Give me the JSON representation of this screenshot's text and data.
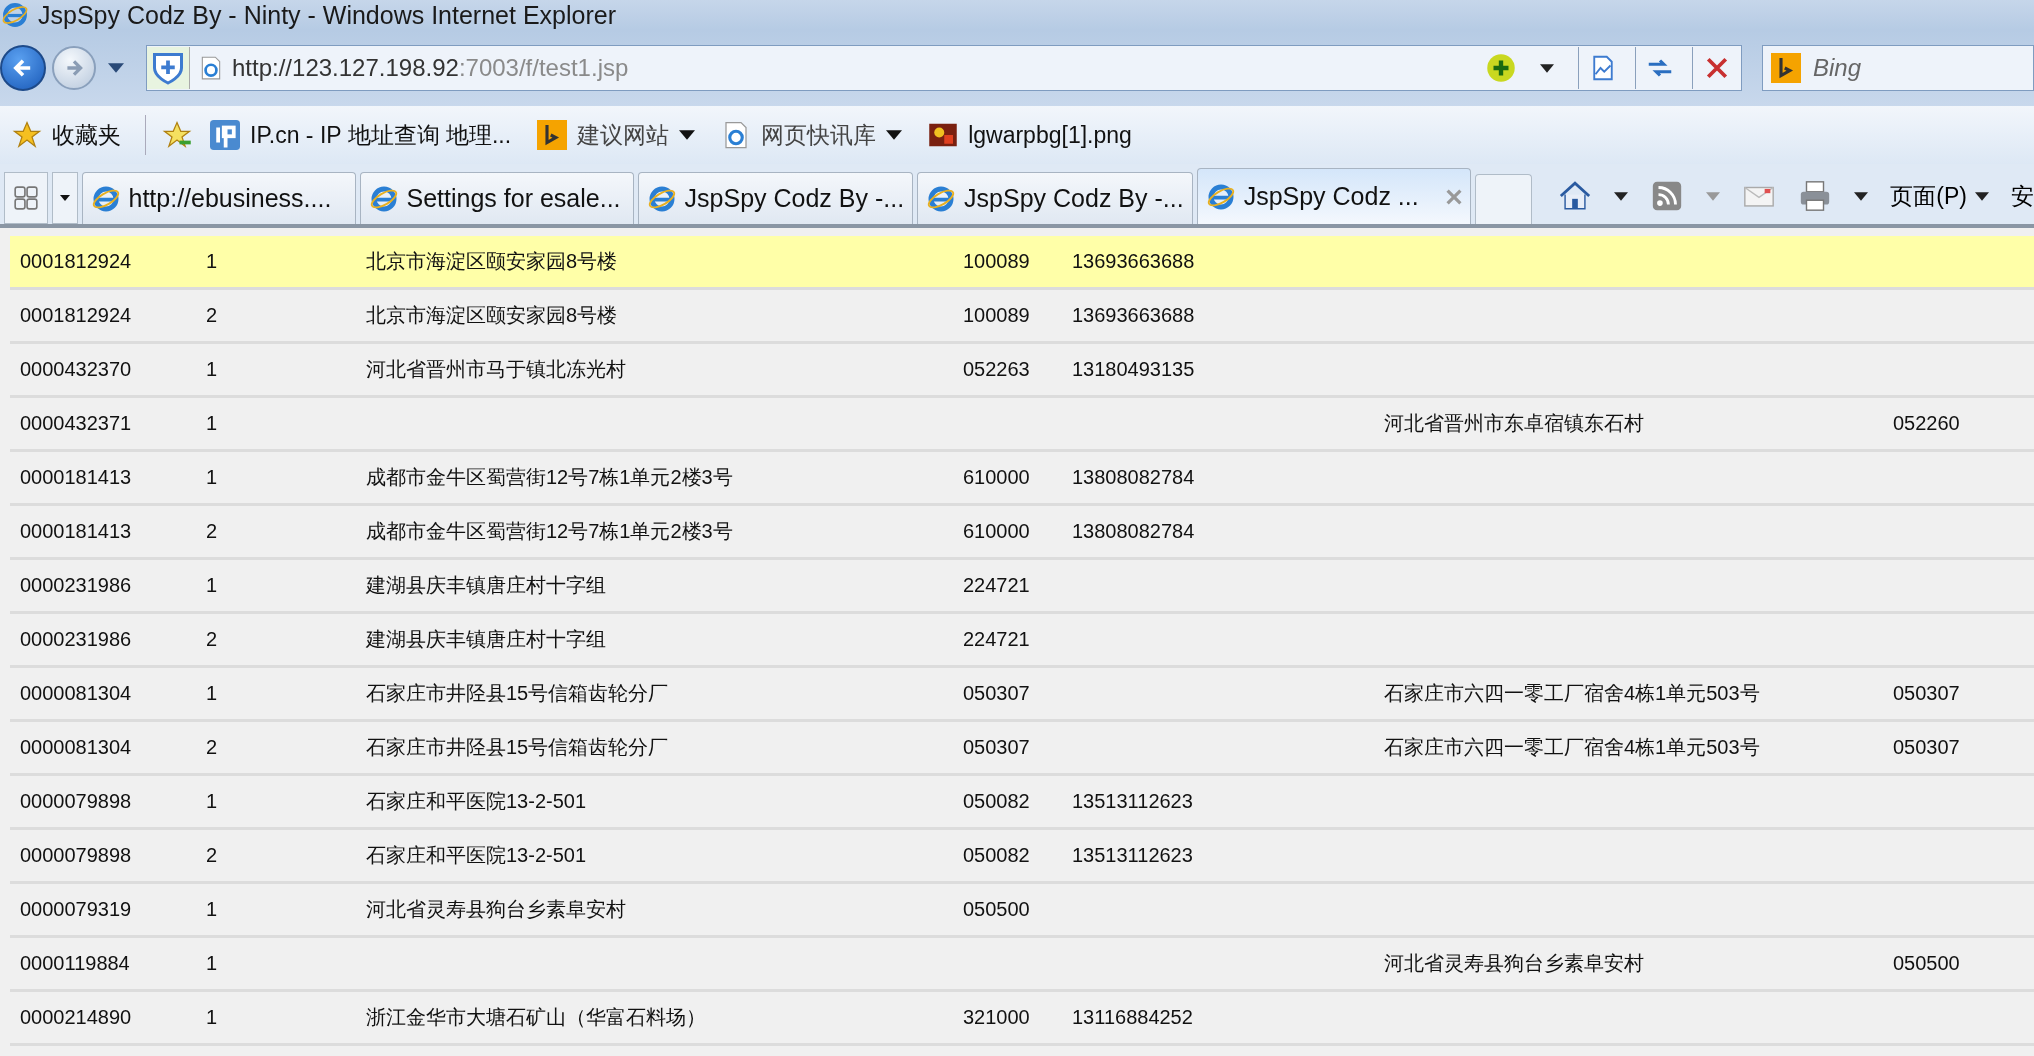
{
  "window": {
    "title": "JspSpy Codz By - Ninty - Windows Internet Explorer"
  },
  "address_bar": {
    "url_host": "http://123.127.198.92",
    "url_rest": ":7003/f/test1.jsp"
  },
  "search": {
    "placeholder": "Bing"
  },
  "favorites_bar": {
    "favorites_label": "收藏夹",
    "items": [
      {
        "kind": "ipcn",
        "label": "IP.cn - IP 地址查询  地理...",
        "dropdown": false
      },
      {
        "kind": "bing",
        "label": "建议网站",
        "dropdown": true
      },
      {
        "kind": "ie",
        "label": "网页快讯库",
        "dropdown": true
      },
      {
        "kind": "image",
        "label": "lgwarpbg[1].png",
        "dropdown": false
      }
    ]
  },
  "tabs": [
    {
      "label": "http://ebusiness....",
      "selected": false
    },
    {
      "label": "Settings for esale...",
      "selected": false
    },
    {
      "label": "JspSpy Codz By -...",
      "selected": false
    },
    {
      "label": "JspSpy Codz By -...",
      "selected": false
    },
    {
      "label": "JspSpy Codz ...",
      "selected": true
    }
  ],
  "command_bar": {
    "page_menu": "页面(P)",
    "cut_label": "安"
  },
  "table": {
    "rows": [
      {
        "selected": true,
        "cells": [
          "0001812924",
          "1",
          "北京市海淀区颐安家园8号楼",
          "100089",
          "13693663688",
          "",
          ""
        ]
      },
      {
        "selected": false,
        "cells": [
          "0001812924",
          "2",
          "北京市海淀区颐安家园8号楼",
          "100089",
          "13693663688",
          "",
          ""
        ]
      },
      {
        "selected": false,
        "cells": [
          "0000432370",
          "1",
          "河北省晋州市马于镇北冻光村",
          "052263",
          "13180493135",
          "",
          ""
        ]
      },
      {
        "selected": false,
        "cells": [
          "0000432371",
          "1",
          "",
          "",
          "",
          "河北省晋州市东卓宿镇东石村",
          "052260"
        ]
      },
      {
        "selected": false,
        "cells": [
          "0000181413",
          "1",
          "成都市金牛区蜀营街12号7栋1单元2楼3号",
          "610000",
          "13808082784",
          "",
          ""
        ]
      },
      {
        "selected": false,
        "cells": [
          "0000181413",
          "2",
          "成都市金牛区蜀营街12号7栋1单元2楼3号",
          "610000",
          "13808082784",
          "",
          ""
        ]
      },
      {
        "selected": false,
        "cells": [
          "0000231986",
          "1",
          "建湖县庆丰镇唐庄村十字组",
          "224721",
          "",
          "",
          ""
        ]
      },
      {
        "selected": false,
        "cells": [
          "0000231986",
          "2",
          "建湖县庆丰镇唐庄村十字组",
          "224721",
          "",
          "",
          ""
        ]
      },
      {
        "selected": false,
        "cells": [
          "0000081304",
          "1",
          "石家庄市井陉县15号信箱齿轮分厂",
          "050307",
          "",
          "石家庄市六四一零工厂宿舍4栋1单元503号",
          "050307"
        ]
      },
      {
        "selected": false,
        "cells": [
          "0000081304",
          "2",
          "石家庄市井陉县15号信箱齿轮分厂",
          "050307",
          "",
          "石家庄市六四一零工厂宿舍4栋1单元503号",
          "050307"
        ]
      },
      {
        "selected": false,
        "cells": [
          "0000079898",
          "1",
          "石家庄和平医院13-2-501",
          "050082",
          "13513112623",
          "",
          ""
        ]
      },
      {
        "selected": false,
        "cells": [
          "0000079898",
          "2",
          "石家庄和平医院13-2-501",
          "050082",
          "13513112623",
          "",
          ""
        ]
      },
      {
        "selected": false,
        "cells": [
          "0000079319",
          "1",
          "河北省灵寿县狗台乡素阜安村",
          "050500",
          "",
          "",
          ""
        ]
      },
      {
        "selected": false,
        "cells": [
          "0000119884",
          "1",
          "",
          "",
          "",
          "河北省灵寿县狗台乡素阜安村",
          "050500"
        ]
      },
      {
        "selected": false,
        "cells": [
          "0000214890",
          "1",
          "浙江金华市大塘石矿山（华富石料场）",
          "321000",
          "13116884252",
          "",
          ""
        ]
      }
    ]
  }
}
